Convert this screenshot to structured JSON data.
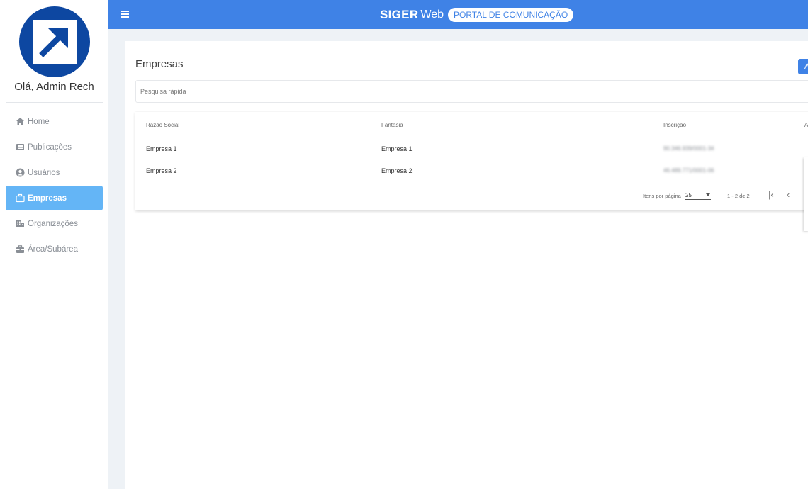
{
  "user": {
    "greeting": "Olá, Admin Rech"
  },
  "sidebar": {
    "items": [
      {
        "label": "Home",
        "icon": "home-icon"
      },
      {
        "label": "Publicações",
        "icon": "inbox-icon"
      },
      {
        "label": "Usuários",
        "icon": "user-circle-icon"
      },
      {
        "label": "Empresas",
        "icon": "briefcase-icon",
        "active": true
      },
      {
        "label": "Organizações",
        "icon": "building-icon"
      },
      {
        "label": "Área/Subárea",
        "icon": "toolbox-icon"
      }
    ]
  },
  "header": {
    "brand_main": "SIGER",
    "brand_sub": "Web",
    "brand_tag": "PORTAL DE COMUNICAÇÃO",
    "color": "#3f82e6"
  },
  "main": {
    "title": "Empresas",
    "add_label": "A",
    "search_placeholder": "Pesquisa rápida",
    "table": {
      "columns": [
        "Razão Social",
        "Fantasia",
        "Inscrição",
        "A"
      ],
      "rows": [
        {
          "razao": "Empresa 1",
          "fantasia": "Empresa 1",
          "inscricao": "90.346.939/0001-34"
        },
        {
          "razao": "Empresa 2",
          "fantasia": "Empresa 2",
          "inscricao": "46.489.771/0001-06"
        }
      ]
    },
    "paginator": {
      "label": "Itens por página",
      "page_size": "25",
      "range": "1 - 2 de 2"
    }
  }
}
